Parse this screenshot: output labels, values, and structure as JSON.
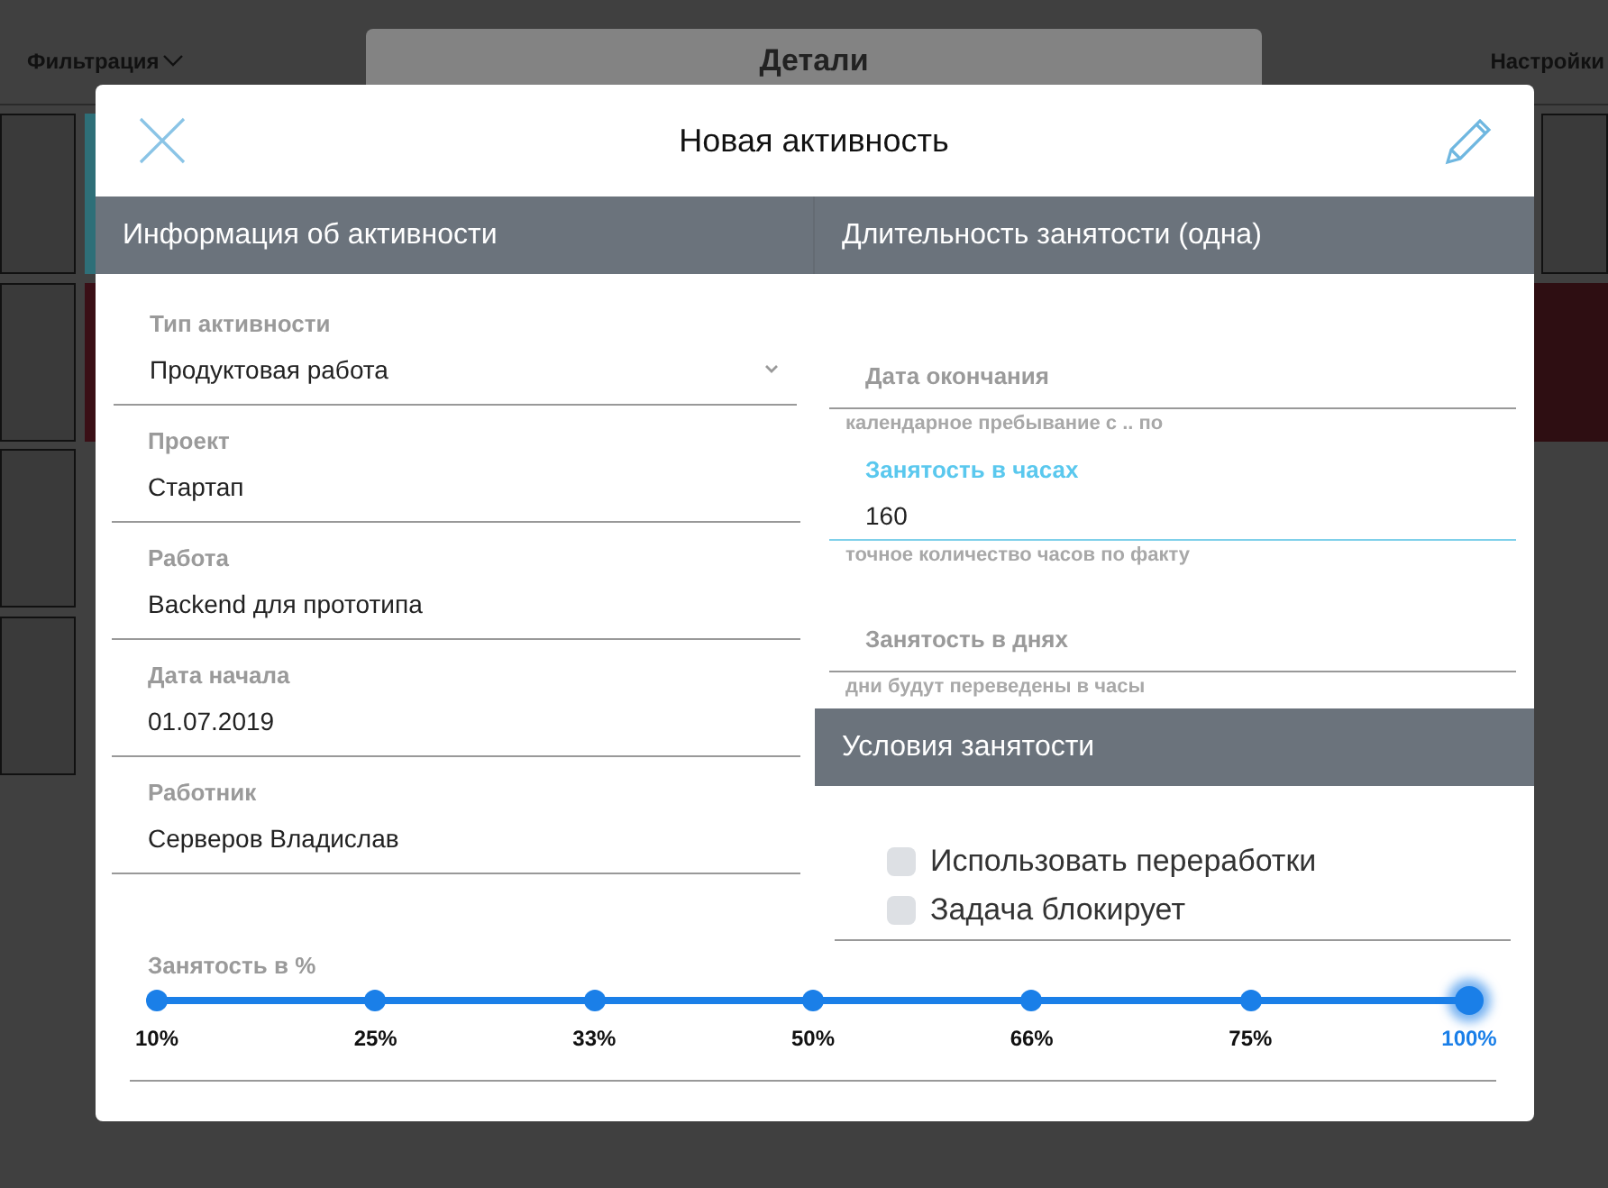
{
  "background": {
    "filter_label": "Фильтрация",
    "settings_label": "Настройки",
    "panel_title": "Детали"
  },
  "dialog": {
    "title": "Новая активность"
  },
  "left_section": {
    "title": "Информация об активности",
    "fields": [
      {
        "kind": "select",
        "label": "Тип активности",
        "value": "Продуктовая работа"
      },
      {
        "kind": "text",
        "label": "Проект",
        "value": "Стартап"
      },
      {
        "kind": "text",
        "label": "Работа",
        "value": "Backend для прототипа"
      },
      {
        "kind": "text",
        "label": "Дата начала",
        "value": "01.07.2019"
      },
      {
        "kind": "text",
        "label": "Работник",
        "value": "Серверов Владислав"
      }
    ]
  },
  "right_section": {
    "title": "Длительность занятости (одна)",
    "fields": [
      {
        "label": "Дата окончания",
        "helper": "календарное пребывание с .. по",
        "focused": false
      },
      {
        "label": "Занятость в часах",
        "value": "160",
        "helper": "точное количество часов по факту",
        "focused": true
      },
      {
        "label": "Занятость в днях",
        "helper": "дни будут переведены в часы",
        "focused": false
      }
    ]
  },
  "conditions": {
    "title": "Условия занятости",
    "checkboxes": [
      {
        "label": "Использовать переработки",
        "checked": false
      },
      {
        "label": "Задача блокирует",
        "checked": false
      }
    ]
  },
  "employment_slider": {
    "label": "Занятость в %",
    "level": 1,
    "stops": [
      {
        "label": "10%",
        "selected": false
      },
      {
        "label": "25%",
        "selected": false
      },
      {
        "label": "33%",
        "selected": false
      },
      {
        "label": "50%",
        "selected": false
      },
      {
        "label": "66%",
        "selected": false
      },
      {
        "label": "75%",
        "selected": false
      },
      {
        "label": "100%",
        "selected": true
      }
    ]
  }
}
